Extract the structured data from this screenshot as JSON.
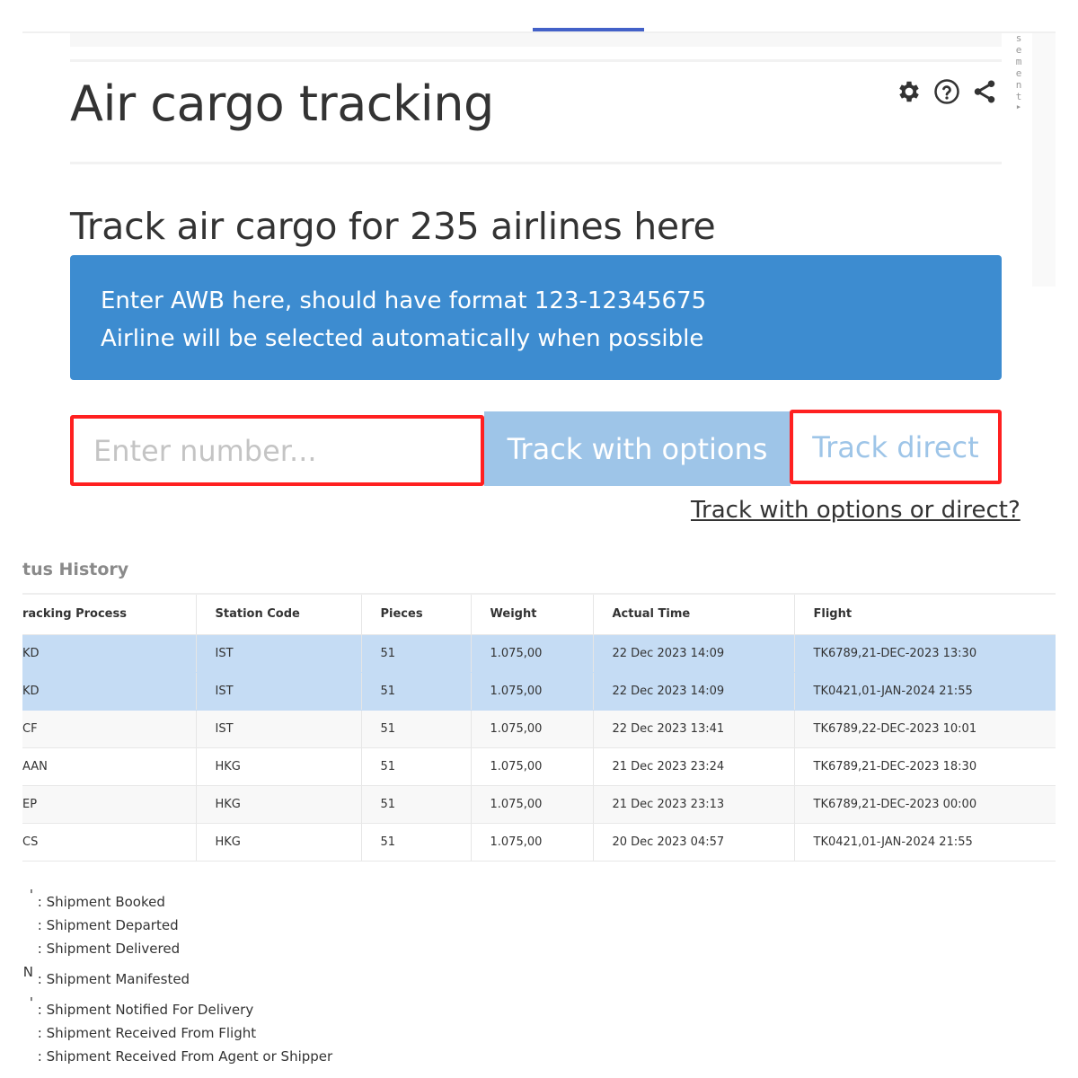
{
  "header": {
    "title": "Air cargo tracking",
    "vertical_label": "sement",
    "icons": [
      {
        "name": "gear-icon",
        "label": "Settings"
      },
      {
        "name": "help-circle-icon",
        "label": "Help"
      },
      {
        "name": "share-icon",
        "label": "Share"
      }
    ]
  },
  "intro": {
    "subheading": "Track air cargo for 235 airlines here",
    "info_line_1": "Enter AWB here, should have format 123-12345675",
    "info_line_2": "Airline will be selected automatically when possible"
  },
  "tracking_form": {
    "input_value": "",
    "input_placeholder": "Enter number...",
    "track_options_label": "Track with options",
    "track_direct_label": "Track direct",
    "help_link": "Track with options or direct?"
  },
  "colors": {
    "accent_blue": "#3d8cd0",
    "light_blue_button": "#9ec5e8",
    "highlight_border": "#ff2020",
    "row_highlight": "#c5dcf4",
    "tab_indicator": "#4361c8"
  },
  "status_history": {
    "heading": "tus History",
    "columns": [
      "racking Process",
      "Station Code",
      "Pieces",
      "Weight",
      "Actual Time",
      "Flight"
    ],
    "rows": [
      {
        "process": "KD",
        "station": "IST",
        "pieces": "51",
        "weight": "1.075,00",
        "time": "22 Dec 2023 14:09",
        "flight": "TK6789,21-DEC-2023 13:30",
        "style": "highlight"
      },
      {
        "process": "KD",
        "station": "IST",
        "pieces": "51",
        "weight": "1.075,00",
        "time": "22 Dec 2023 14:09",
        "flight": "TK0421,01-JAN-2024 21:55",
        "style": "highlight"
      },
      {
        "process": "CF",
        "station": "IST",
        "pieces": "51",
        "weight": "1.075,00",
        "time": "22 Dec 2023 13:41",
        "flight": "TK6789,22-DEC-2023 10:01",
        "style": "alt"
      },
      {
        "process": "AAN",
        "station": "HKG",
        "pieces": "51",
        "weight": "1.075,00",
        "time": "21 Dec 2023 23:24",
        "flight": "TK6789,21-DEC-2023 18:30",
        "style": "plain"
      },
      {
        "process": "EP",
        "station": "HKG",
        "pieces": "51",
        "weight": "1.075,00",
        "time": "21 Dec 2023 23:13",
        "flight": "TK6789,21-DEC-2023 00:00",
        "style": "alt"
      },
      {
        "process": "CS",
        "station": "HKG",
        "pieces": "51",
        "weight": "1.075,00",
        "time": "20 Dec 2023 04:57",
        "flight": "TK0421,01-JAN-2024 21:55",
        "style": "plain"
      }
    ]
  },
  "legend": [
    {
      "code": "'",
      "text": ": Shipment Booked"
    },
    {
      "code": "",
      "text": ": Shipment Departed"
    },
    {
      "code": "",
      "text": ": Shipment Delivered"
    },
    {
      "code": "N",
      "text": ": Shipment Manifested"
    },
    {
      "code": "'",
      "text": ": Shipment Notified For Delivery"
    },
    {
      "code": "",
      "text": ": Shipment Received From Flight"
    },
    {
      "code": "",
      "text": ": Shipment Received From Agent or Shipper"
    }
  ]
}
